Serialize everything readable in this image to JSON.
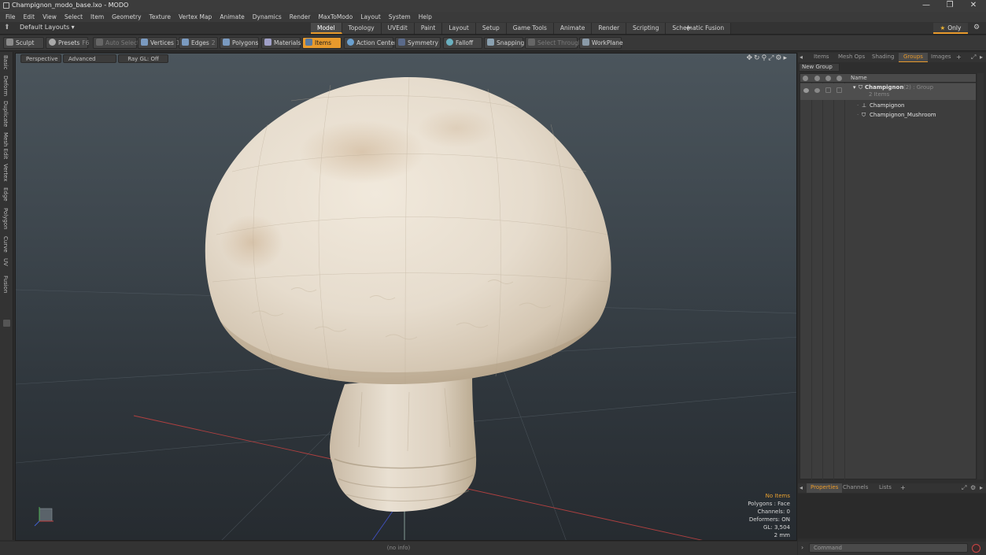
{
  "window": {
    "title": "Champignon_modo_base.lxo - MODO",
    "minimize": "—",
    "restore": "❐",
    "close": "✕"
  },
  "menu": [
    "File",
    "Edit",
    "View",
    "Select",
    "Item",
    "Geometry",
    "Texture",
    "Vertex Map",
    "Animate",
    "Dynamics",
    "Render",
    "MaxToModo",
    "Layout",
    "System",
    "Help"
  ],
  "layout_selector": "Default Layouts ▾",
  "mode_tabs": [
    "Model",
    "Topology",
    "UVEdit",
    "Paint",
    "Layout",
    "Setup",
    "Game Tools",
    "Animate",
    "Render",
    "Scripting",
    "Schematic Fusion"
  ],
  "active_tab": "Model",
  "only_button": "Only",
  "toolbar": {
    "sculpt": "Sculpt",
    "presets": "Presets",
    "presets_key": "F6",
    "auto_select": "Auto Select",
    "vertices": "Vertices",
    "vertices_key": "1",
    "edges": "Edges",
    "edges_key": "2",
    "polygons": "Polygons",
    "materials": "Materials",
    "items": "Items",
    "action_center": "Action Center",
    "symmetry": "Symmetry",
    "falloff": "Falloff",
    "snapping": "Snapping",
    "select_through": "Select Through",
    "workplane": "WorkPlane"
  },
  "left_strip_tabs": [
    "Basic",
    "Deform",
    "Duplicate",
    "Mesh Edit",
    "Vertex",
    "Edge",
    "Polygon",
    "Curve",
    "UV",
    "Fusion"
  ],
  "viewport": {
    "view_mode": "Perspective",
    "shading": "Advanced",
    "raygl": "Ray GL: Off",
    "info": {
      "no_items": "No Items",
      "polygons": "Polygons : Face",
      "channels": "Channels: 0",
      "deformers": "Deformers: ON",
      "gl": "GL: 3,504",
      "unit": "2 mm"
    }
  },
  "status_text": "(no info)",
  "right_panel": {
    "tabs": [
      "Items",
      "Mesh Ops",
      "Shading",
      "Groups",
      "Images"
    ],
    "active_tab": "Groups",
    "new_group": "New Group",
    "column_name": "Name",
    "group": {
      "name": "Champignon",
      "meta": "(2) : Group",
      "count": "2 Items",
      "children": [
        "Champignon",
        "Champignon_Mushroom"
      ]
    },
    "bottom_tabs": [
      "Properties",
      "Channels",
      "Lists"
    ],
    "active_bottom_tab": "Properties"
  },
  "command_placeholder": "Command",
  "colors": {
    "accent": "#e89a2c",
    "mushroom_cap": "#e6dccd",
    "mushroom_stem": "#ddd1c0"
  }
}
